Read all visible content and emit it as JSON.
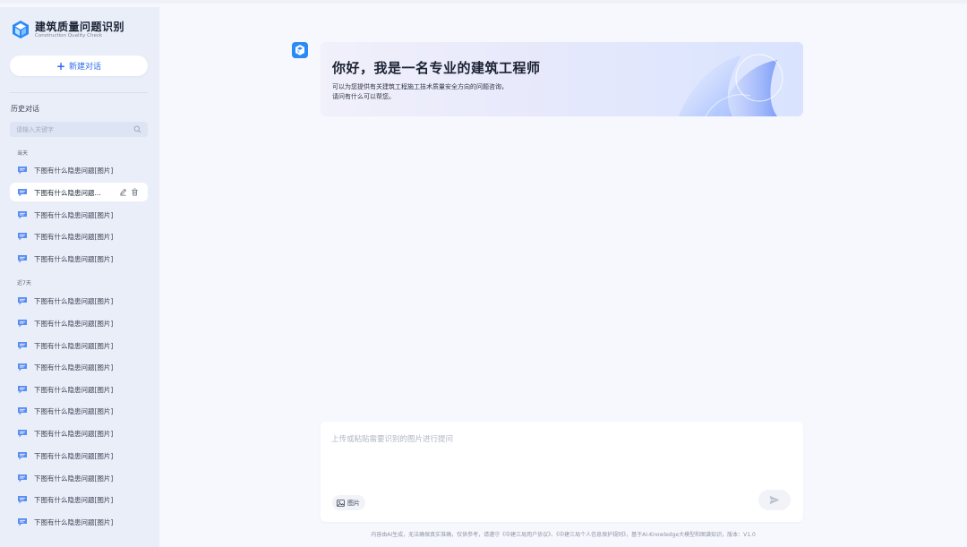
{
  "app": {
    "title": "建筑质量问题识别",
    "subtitle": "Construction Quality Check"
  },
  "sidebar": {
    "new_chat_label": "新建对话",
    "history_title": "历史对话",
    "search_placeholder": "请输入关键字",
    "groups": [
      {
        "label": "当天",
        "items": [
          {
            "label": "下图有什么隐患问题[图片]",
            "active": false
          },
          {
            "label": "下图有什么隐患问题...",
            "active": true
          },
          {
            "label": "下图有什么隐患问题[图片]",
            "active": false
          },
          {
            "label": "下图有什么隐患问题[图片]",
            "active": false
          },
          {
            "label": "下图有什么隐患问题[图片]",
            "active": false
          }
        ]
      },
      {
        "label": "近7天",
        "items": [
          {
            "label": "下图有什么隐患问题[图片]"
          },
          {
            "label": "下图有什么隐患问题[图片]"
          },
          {
            "label": "下图有什么隐患问题[图片]"
          },
          {
            "label": "下图有什么隐患问题[图片]"
          },
          {
            "label": "下图有什么隐患问题[图片]"
          },
          {
            "label": "下图有什么隐患问题[图片]"
          },
          {
            "label": "下图有什么隐患问题[图片]"
          },
          {
            "label": "下图有什么隐患问题[图片]"
          },
          {
            "label": "下图有什么隐患问题[图片]"
          },
          {
            "label": "下图有什么隐患问题[图片]"
          },
          {
            "label": "下图有什么隐患问题[图片]"
          }
        ]
      }
    ]
  },
  "welcome": {
    "title": "你好，我是一名专业的建筑工程师",
    "line1": "可以为您提供有关建筑工程施工技术质量安全方向的问题咨询，",
    "line2": "请问有什么可以帮您。"
  },
  "composer": {
    "placeholder": "上传或粘贴需要识别的图片进行提问",
    "image_button_label": "图片"
  },
  "footer": {
    "note": "内容由AI生成，无法确保真实准确，仅供参考，请遵守《中建三局用户协议》、《中建三局个人信息保护规则》，基于AI-Knowledge大模型和图谱知识，版本：V1.0"
  },
  "colors": {
    "accent": "#2e6bf0",
    "sidebar_bg": "#e9eef9",
    "main_bg": "#f6f8fd",
    "chat_icon": "#5a8df2",
    "logo": "#2b8af5"
  },
  "icons": {
    "brand": "cube-logo-icon",
    "new_chat": "plus-icon",
    "search": "search-icon",
    "history_item": "chat-bubble-icon",
    "edit": "edit-icon",
    "delete": "trash-icon",
    "image": "image-icon",
    "send": "send-icon"
  }
}
